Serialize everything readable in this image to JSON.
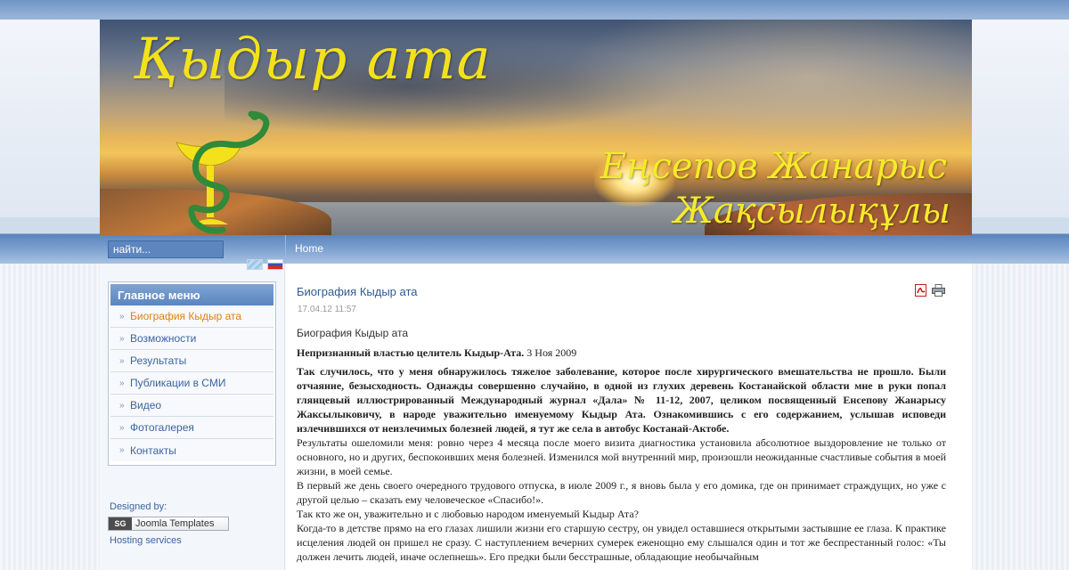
{
  "header": {
    "brand_title": "Қыдыр ата",
    "brand_name_line1": "Еңсепов Жанарыс",
    "brand_name_line2": "Жақсылықұлы"
  },
  "nav": {
    "search_placeholder": "найти...",
    "breadcrumb": "Home",
    "languages": [
      "kz-flag-icon",
      "ru-flag-icon"
    ]
  },
  "menu": {
    "title": "Главное меню",
    "items": [
      {
        "label": "Биография Кыдыр ата",
        "active": true
      },
      {
        "label": "Возможности",
        "active": false
      },
      {
        "label": "Результаты",
        "active": false
      },
      {
        "label": "Публикации в СМИ",
        "active": false
      },
      {
        "label": "Видео",
        "active": false
      },
      {
        "label": "Фотогалерея",
        "active": false
      },
      {
        "label": "Контакты",
        "active": false
      }
    ]
  },
  "footer_left": {
    "designed_by": "Designed by:",
    "badge_logo": "SG",
    "badge_text": "Joomla Templates",
    "hosting": "Hosting services"
  },
  "article": {
    "title": "Биография Кыдыр ата",
    "date": "17.04.12 11:57",
    "intro": "Биография Кыдыр ата",
    "subtitle_bold": "Непризнанный властью целитель Кыдыр-Ата.",
    "subtitle_date": " 3 Ноя 2009",
    "bold_paragraph": "Так случилось, что у меня обнаружилось тяжелое заболевание, которое после хирургического вмешательства не прошло. Были отчаяние, безысходность. Однажды совершенно случайно, в одной из глухих деревень Костанайской области мне в руки попал глянцевый иллюстрированный Международный журнал «Дала» № 11-12, 2007, целиком посвященный Енсепову Жанарысу Жаксылыковичу, в народе уважительно именуемому Кыдыр Ата. Ознакомившись с его содержанием, услышав исповеди излечившихся от неизлечимых болезней людей, я тут же села в автобус Костанай-Актобе.",
    "paragraphs": [
      "Результаты ошеломили меня: ровно через 4 месяца после моего визита диагностика установила абсолютное выздоровление не только от основного, но и других, беспокоивших меня болезней. Изменился мой внутренний мир, произошли неожиданные счастливые события в моей жизни, в моей семье.",
      "В первый же день своего очередного трудового отпуска, в июле 2009 г., я вновь была у его домика, где он принимает страждущих, но уже с другой целью – сказать ему человеческое «Спасибо!».",
      "Так кто же он, уважительно и с любовью народом именуемый Кыдыр Ата?",
      "Когда-то в детстве прямо на его глазах лишили жизни его старшую сестру, он увидел оставшиеся открытыми застывшие ее глаза. К практике исцеления людей он пришел не сразу. С наступлением вечерних сумерек еженощно ему слышался один и тот же беспрестанный голос: «Ты должен лечить людей, иначе ослепнешь». Его предки были бесстрашные, обладающие необычайным"
    ]
  },
  "colors": {
    "accent_blue": "#5b85be",
    "link_blue": "#3a64a1",
    "active_orange": "#e07f12",
    "brand_yellow": "#f3e21b"
  }
}
